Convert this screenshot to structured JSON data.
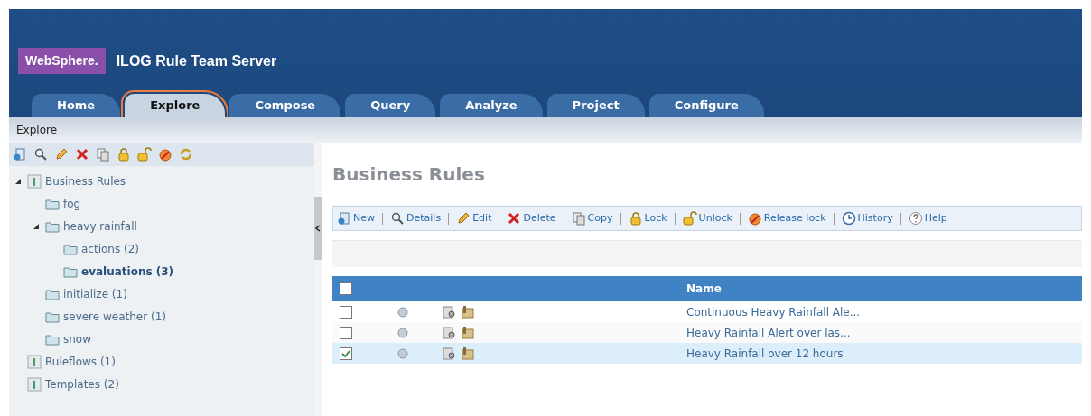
{
  "header": {
    "brand": "WebSphere.",
    "product": "ILOG Rule Team Server"
  },
  "tabs": [
    {
      "label": "Home",
      "selected": false,
      "highlighted": false
    },
    {
      "label": "Explore",
      "selected": true,
      "highlighted": true
    },
    {
      "label": "Compose",
      "selected": false,
      "highlighted": false
    },
    {
      "label": "Query",
      "selected": false,
      "highlighted": false
    },
    {
      "label": "Analyze",
      "selected": false,
      "highlighted": false
    },
    {
      "label": "Project",
      "selected": false,
      "highlighted": false
    },
    {
      "label": "Configure",
      "selected": false,
      "highlighted": false
    }
  ],
  "breadcrumb": "Explore",
  "tree": [
    {
      "label": "Business Rules",
      "kind": "project",
      "expanded": true,
      "selected": false,
      "children": [
        {
          "label": "fog",
          "kind": "folder",
          "selected": false
        },
        {
          "label": "heavy rainfall",
          "kind": "folder",
          "expanded": true,
          "selected": false,
          "children": [
            {
              "label": "actions (2)",
              "kind": "folder",
              "selected": false
            },
            {
              "label": "evaluations (3)",
              "kind": "folder",
              "selected": true
            }
          ]
        },
        {
          "label": "initialize (1)",
          "kind": "folder",
          "selected": false
        },
        {
          "label": "severe weather (1)",
          "kind": "folder",
          "selected": false
        },
        {
          "label": "snow",
          "kind": "folder",
          "selected": false
        }
      ]
    },
    {
      "label": "Ruleflows (1)",
      "kind": "project",
      "selected": false
    },
    {
      "label": "Templates (2)",
      "kind": "project",
      "selected": false
    }
  ],
  "main": {
    "title": "Business Rules",
    "actions": [
      "New",
      "Details",
      "Edit",
      "Delete",
      "Copy",
      "Lock",
      "Unlock",
      "Release lock",
      "History",
      "Help"
    ],
    "table": {
      "select_all": {
        "checked": false
      },
      "columns": [
        "Name"
      ],
      "rows": [
        {
          "name": "Continuous Heavy Rainfall Ale...",
          "checked": false,
          "selected": false
        },
        {
          "name": "Heavy Rainfall Alert over las...",
          "checked": false,
          "selected": false
        },
        {
          "name": "Heavy Rainfall over 12 hours",
          "checked": true,
          "selected": true
        }
      ]
    }
  }
}
